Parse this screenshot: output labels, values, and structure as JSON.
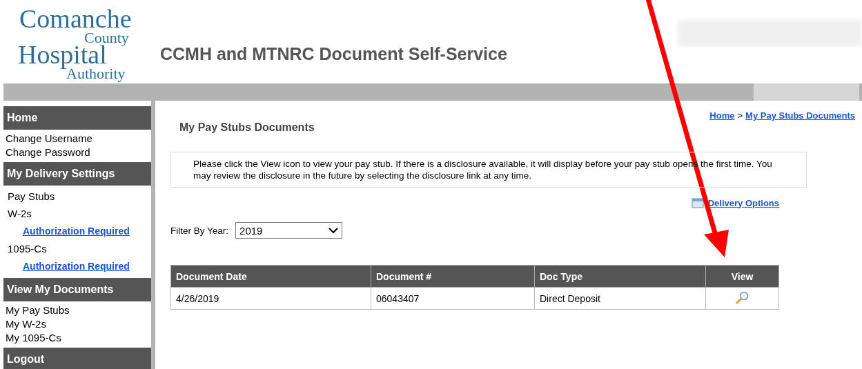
{
  "header": {
    "logo_lines": [
      "Comanche",
      "County",
      "Hospital",
      "Authority"
    ],
    "title": "CCMH and MTNRC Document Self-Service"
  },
  "sidebar": [
    {
      "kind": "heading",
      "label": "Home"
    },
    {
      "kind": "item",
      "label": "Change Username"
    },
    {
      "kind": "item",
      "label": "Change Password"
    },
    {
      "kind": "heading",
      "label": "My Delivery Settings"
    },
    {
      "kind": "setting",
      "label": "Pay Stubs"
    },
    {
      "kind": "setting",
      "label": "W-2s"
    },
    {
      "kind": "link",
      "label": "Authorization Required"
    },
    {
      "kind": "setting",
      "label": "1095-Cs"
    },
    {
      "kind": "link",
      "label": "Authorization Required"
    },
    {
      "kind": "heading",
      "label": "View My Documents"
    },
    {
      "kind": "item",
      "label": "My Pay Stubs"
    },
    {
      "kind": "item",
      "label": "My W-2s"
    },
    {
      "kind": "item",
      "label": "My 1095-Cs"
    },
    {
      "kind": "heading",
      "label": "Logout"
    }
  ],
  "breadcrumb": [
    "Home",
    "My Pay Stubs Documents"
  ],
  "breadcrumb_separator": ">",
  "page_title": "My Pay Stubs Documents",
  "notice": "Please click the View icon to view your pay stub. If there is a disclosure available, it will display before your pay stub opens the first time. You may review the disclosure in the future by selecting the disclosure link at any time.",
  "delivery_options": "Delivery Options",
  "filter": {
    "label": "Filter By Year:",
    "value": "2019"
  },
  "table": {
    "columns": [
      "Document Date",
      "Document #",
      "Doc Type",
      "View"
    ],
    "rows": [
      {
        "cells": [
          "4/26/2019",
          "06043407",
          "Direct Deposit"
        ]
      }
    ]
  }
}
